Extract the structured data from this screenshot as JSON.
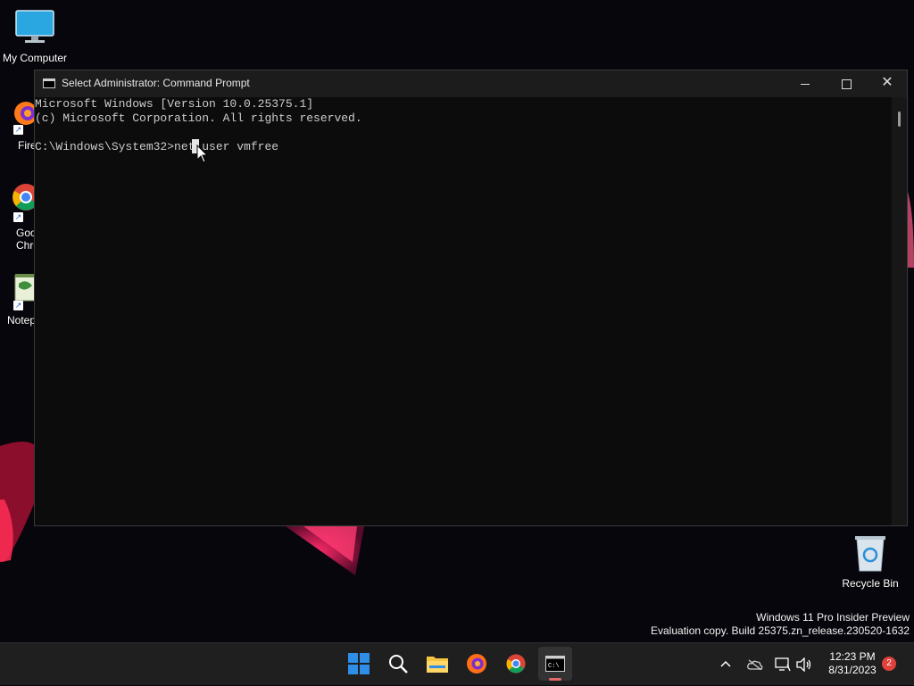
{
  "desktop": {
    "icons": [
      {
        "label": "My Computer"
      },
      {
        "label": "Firef"
      },
      {
        "label": "Goo\nChro"
      },
      {
        "label": "Notep"
      },
      {
        "label": "Recycle Bin"
      }
    ]
  },
  "window": {
    "title": "Select Administrator:  Command Prompt",
    "console_lines": [
      "Microsoft Windows [Version 10.0.25375.1]",
      "(c) Microsoft Corporation. All rights reserved.",
      "",
      "C:\\Windows\\System32>net user vmfree"
    ]
  },
  "watermark": {
    "line1": "Windows 11 Pro Insider Preview",
    "line2": "Evaluation copy. Build 25375.zn_release.230520-1632"
  },
  "taskbar": {
    "items": [
      "start-icon",
      "search-icon",
      "file-explorer-icon",
      "firefox-icon",
      "chrome-icon",
      "command-prompt-icon"
    ],
    "tray": [
      "chevron-up-icon",
      "onedrive-icon",
      "network-icon",
      "volume-icon"
    ],
    "clock": {
      "time": "12:23 PM",
      "date": "8/31/2023"
    },
    "notification_count": "2"
  },
  "colors": {
    "accent": "#0a74da",
    "console_bg": "#0c0c0c",
    "console_text": "#cccccc"
  }
}
